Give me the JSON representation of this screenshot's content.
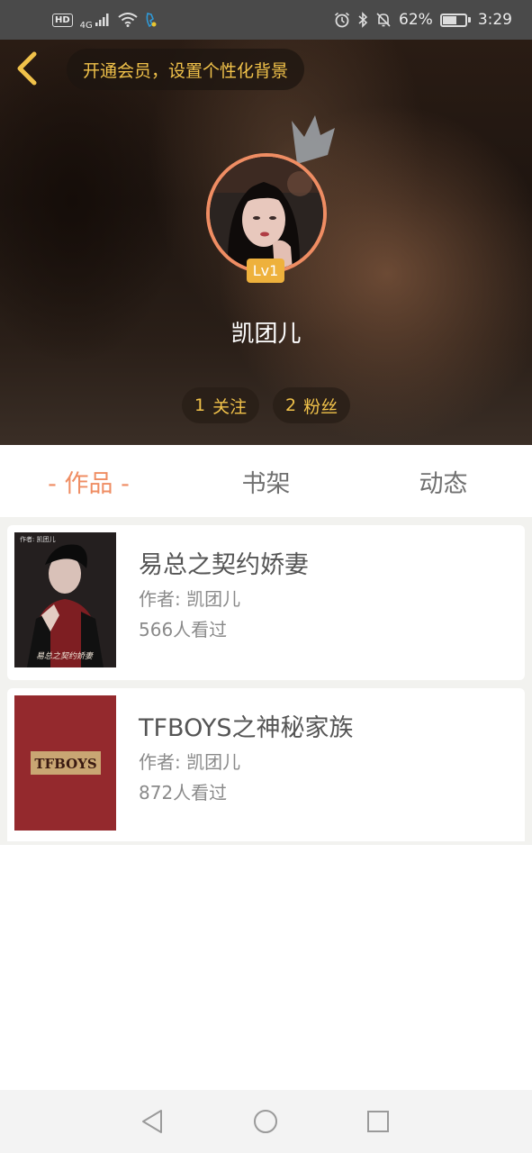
{
  "status_bar": {
    "hd": "HD",
    "network": "4G",
    "battery_text": "62%",
    "battery_level": 0.62,
    "time": "3:29",
    "icons": [
      "signal-icon",
      "wifi-icon",
      "alarm-icon",
      "bluetooth-icon",
      "mute-icon",
      "battery-icon"
    ]
  },
  "header": {
    "vip_banner": "开通会员，设置个性化背景",
    "level": "Lv1",
    "username": "凯团儿",
    "stats": {
      "follow_count": "1",
      "follow_label": "关注",
      "fans_count": "2",
      "fans_label": "粉丝"
    }
  },
  "tabs": [
    {
      "label": "- 作品 -",
      "active": true
    },
    {
      "label": "书架",
      "active": false
    },
    {
      "label": "动态",
      "active": false
    }
  ],
  "works": [
    {
      "title": "易总之契约娇妻",
      "author": "作者: 凯团儿",
      "views": "566人看过",
      "cover_caption": "易总之契约娇妻",
      "cover_tag": "作者: 凯团儿"
    },
    {
      "title": "TFBOYS之神秘家族",
      "author": "作者: 凯团儿",
      "views": "872人看过",
      "cover_caption": "TFBOYS"
    }
  ],
  "colors": {
    "accent": "#ef8d63",
    "gold": "#f1c24a",
    "level_badge": "#eeb13c",
    "status_bar": "#4a4a4a",
    "list_bg": "#f2f2ef",
    "cover_red": "#9b2c30"
  },
  "nav": [
    "back-nav-icon",
    "home-nav-icon",
    "recents-nav-icon"
  ]
}
